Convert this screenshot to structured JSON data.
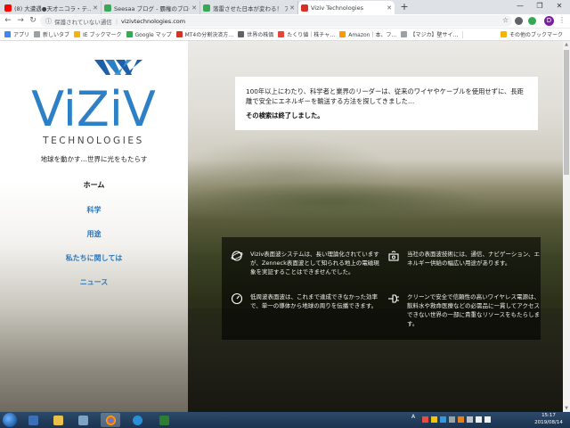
{
  "browser": {
    "tabs": [
      {
        "title": "(8) 大遭遇●天才ニコラ・テ…",
        "color": "#ff0000"
      },
      {
        "title": "Seesaa ブログ - 覇権のブログ…",
        "color": "#3aa757"
      },
      {
        "title": "落雷させた日本が変わる！ ア…",
        "color": "#3aa757"
      },
      {
        "title": "Viziv Technologies",
        "color": "#d93025"
      }
    ],
    "new_tab_label": "+",
    "security_text": "保護されていない通信",
    "url": "vizivtechnologies.com",
    "avatar_initial": "D",
    "bookmarks": [
      {
        "label": "アプリ",
        "color": "#4285f4"
      },
      {
        "label": "新しいタブ",
        "color": "#9aa0a6"
      },
      {
        "label": "IE ブックマーク",
        "color": "#f4b400"
      },
      {
        "label": "Google マップ",
        "color": "#34a853"
      },
      {
        "label": "MT4の分割決済方…",
        "color": "#d93025"
      },
      {
        "label": "世界の株価",
        "color": "#5f6368"
      },
      {
        "label": "たくり値｜株チャ…",
        "color": "#ea4335"
      },
      {
        "label": "Amazon｜本、フ…",
        "color": "#ff9900"
      },
      {
        "label": "【マジカ】壁サイ…",
        "color": "#9aa0a6"
      }
    ],
    "other_bookmarks": "その他のブックマーク"
  },
  "site": {
    "logo_word": "ViZiV",
    "logo_sub": "TECHNOLOGIES",
    "tagline": "地球を動かす…世界に光をもたらす",
    "nav": [
      {
        "label": "ホーム",
        "active": true
      },
      {
        "label": "科学",
        "active": false
      },
      {
        "label": "用途",
        "active": false
      },
      {
        "label": "私たちに関しては",
        "active": false
      },
      {
        "label": "ニュース",
        "active": false
      }
    ],
    "intro_text": "100年以上にわたり、科学者と業界のリーダーは、従来のワイヤやケーブルを使用せずに、長距離で安全にエネルギーを輸送する方法を探してきました…",
    "intro_ended": "その検索は終了しました。",
    "features": [
      {
        "icon": "globe-icon",
        "text": "Viziv表面波システムは、長い理論化されていますが、Zenneck表面波として知られる地上の電磁現象を実証することはできませんでした。"
      },
      {
        "icon": "router-icon",
        "text": "当社の表面波技術には、通信、ナビゲーション、エネルギー供給の幅広い用途があります。"
      },
      {
        "icon": "gauge-icon",
        "text": "低周波表面波は、これまで達成できなかった効率で、単一の導体から地球の周りを伝播できます。"
      },
      {
        "icon": "plug-icon",
        "text": "クリーンで安全で信頼性の高いワイヤレス電源は、飲料水や救命医療などの必需品に一貫してアクセスできない世界の一部に貴重なリソースをもたらします。"
      }
    ]
  },
  "taskbar": {
    "tray_ime": "A",
    "clock_time": "15:17",
    "clock_date": "2019/08/14"
  }
}
